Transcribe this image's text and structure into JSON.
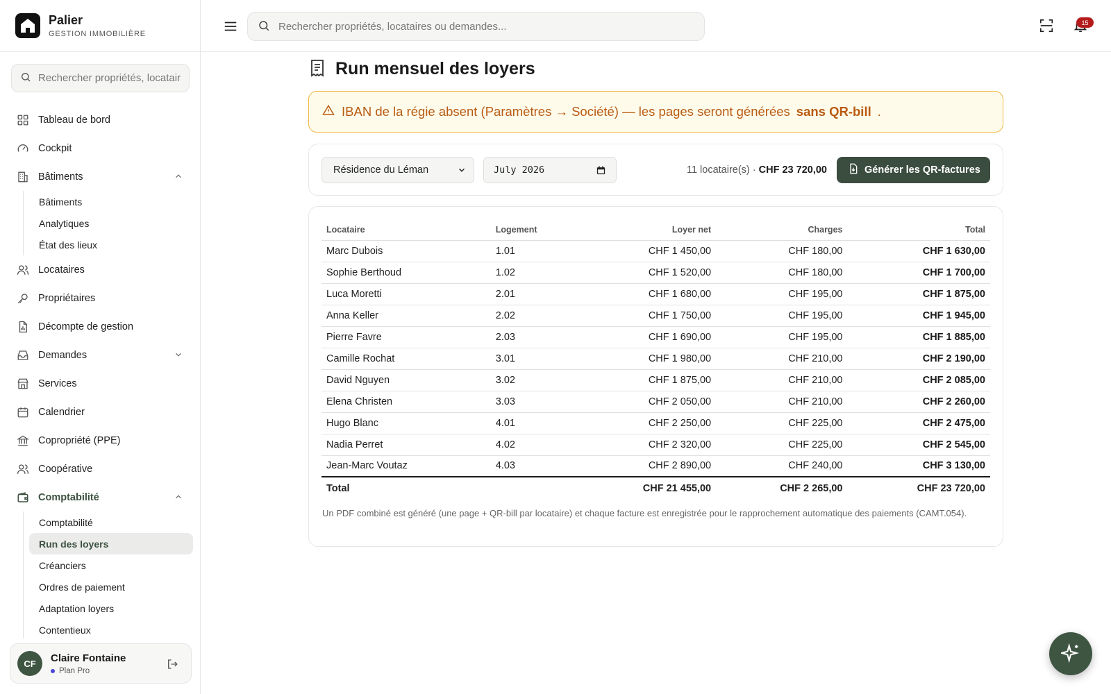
{
  "brand": {
    "name": "Palier",
    "subtitle": "GESTION IMMOBILIÈRE",
    "icon": "house-icon"
  },
  "sidebar": {
    "search_placeholder": "Rechercher propriétés, locataires",
    "items": [
      {
        "label": "Tableau de bord",
        "icon": "grid-icon"
      },
      {
        "label": "Cockpit",
        "icon": "gauge-icon"
      },
      {
        "label": "Bâtiments",
        "icon": "building-icon",
        "expanded": true,
        "children": [
          "Bâtiments",
          "Analytiques",
          "État des lieux"
        ]
      },
      {
        "label": "Locataires",
        "icon": "users-icon"
      },
      {
        "label": "Propriétaires",
        "icon": "key-icon"
      },
      {
        "label": "Décompte de gestion",
        "icon": "document-chart-icon"
      },
      {
        "label": "Demandes",
        "icon": "inbox-icon",
        "expanded": false
      },
      {
        "label": "Services",
        "icon": "store-icon"
      },
      {
        "label": "Calendrier",
        "icon": "calendar-icon"
      },
      {
        "label": "Copropriété (PPE)",
        "icon": "bank-icon"
      },
      {
        "label": "Coopérative",
        "icon": "users-icon"
      },
      {
        "label": "Comptabilité",
        "icon": "wallet-icon",
        "expanded": true,
        "active": true,
        "children": [
          "Comptabilité",
          "Run des loyers",
          "Créanciers",
          "Ordres de paiement",
          "Adaptation loyers",
          "Contentieux"
        ],
        "active_child": "Run des loyers"
      }
    ]
  },
  "user": {
    "initials": "CF",
    "name": "Claire Fontaine",
    "plan": "Plan Pro"
  },
  "topbar": {
    "search_placeholder": "Rechercher propriétés, locataires ou demandes...",
    "notifications": "15"
  },
  "page": {
    "title": "Run mensuel des loyers"
  },
  "alert": {
    "text": "IBAN de la régie absent (Paramètres → Société) — les pages seront générées",
    "strong": "sans QR-bill",
    "end": "."
  },
  "filters": {
    "property": "Résidence du Léman",
    "month": "July 2026",
    "tenant_count": "11 locataire(s) ·",
    "total": "CHF 23 720,00",
    "generate_label": "Générer les QR-factures"
  },
  "table": {
    "headers": [
      "Locataire",
      "Logement",
      "Loyer net",
      "Charges",
      "Total"
    ],
    "rows": [
      [
        "Marc Dubois",
        "1.01",
        "CHF 1 450,00",
        "CHF 180,00",
        "CHF 1 630,00"
      ],
      [
        "Sophie Berthoud",
        "1.02",
        "CHF 1 520,00",
        "CHF 180,00",
        "CHF 1 700,00"
      ],
      [
        "Luca Moretti",
        "2.01",
        "CHF 1 680,00",
        "CHF 195,00",
        "CHF 1 875,00"
      ],
      [
        "Anna Keller",
        "2.02",
        "CHF 1 750,00",
        "CHF 195,00",
        "CHF 1 945,00"
      ],
      [
        "Pierre Favre",
        "2.03",
        "CHF 1 690,00",
        "CHF 195,00",
        "CHF 1 885,00"
      ],
      [
        "Camille Rochat",
        "3.01",
        "CHF 1 980,00",
        "CHF 210,00",
        "CHF 2 190,00"
      ],
      [
        "David Nguyen",
        "3.02",
        "CHF 1 875,00",
        "CHF 210,00",
        "CHF 2 085,00"
      ],
      [
        "Elena Christen",
        "3.03",
        "CHF 2 050,00",
        "CHF 210,00",
        "CHF 2 260,00"
      ],
      [
        "Hugo Blanc",
        "4.01",
        "CHF 2 250,00",
        "CHF 225,00",
        "CHF 2 475,00"
      ],
      [
        "Nadia Perret",
        "4.02",
        "CHF 2 320,00",
        "CHF 225,00",
        "CHF 2 545,00"
      ],
      [
        "Jean-Marc Voutaz",
        "4.03",
        "CHF 2 890,00",
        "CHF 240,00",
        "CHF 3 130,00"
      ]
    ],
    "total_row": [
      "Total",
      "",
      "CHF 21 455,00",
      "CHF 2 265,00",
      "CHF 23 720,00"
    ],
    "footnote": "Un PDF combiné est généré (une page + QR-bill par locataire) et chaque facture est enregistrée pour le rapprochement automatique des paiements (CAMT.054)."
  },
  "colors": {
    "accent": "#3e5541",
    "alert_text": "#b95b12",
    "alert_border": "#f2b640",
    "badge": "#b51b1b"
  }
}
